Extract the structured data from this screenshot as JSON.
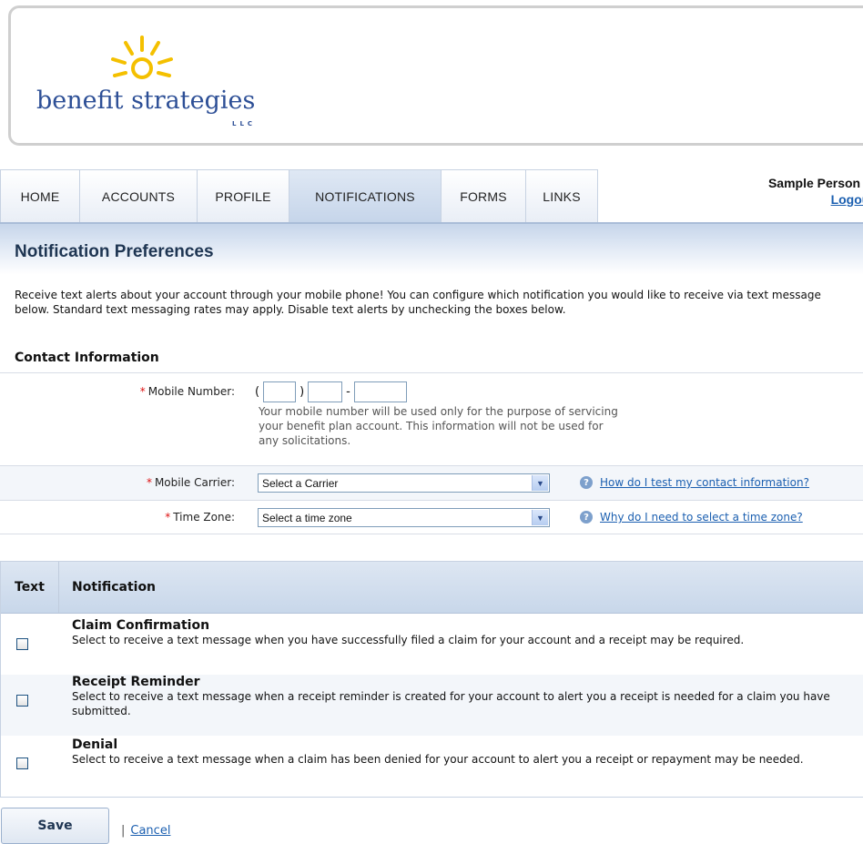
{
  "brand": {
    "name": "benefit strategies",
    "suffix": "LLC",
    "primary_color": "#2d4f96",
    "sun_color": "#f4c000"
  },
  "nav": {
    "tabs": [
      "HOME",
      "ACCOUNTS",
      "PROFILE",
      "NOTIFICATIONS",
      "FORMS",
      "LINKS"
    ],
    "active_tab": "NOTIFICATIONS",
    "user_name": "Sample Person",
    "logout_label": "Logout"
  },
  "page": {
    "title": "Notification Preferences",
    "intro": "Receive text alerts about your account through your mobile phone! You can configure which notification you would like to receive via text message below. Standard text messaging rates may apply. Disable text alerts by unchecking the boxes below."
  },
  "contact": {
    "section_title": "Contact Information",
    "mobile_label": "Mobile Number:",
    "mobile_area": "",
    "mobile_prefix": "",
    "mobile_line": "",
    "mobile_note": "Your mobile number will be used only for the purpose of servicing your benefit plan account. This information will not be used for any solicitations.",
    "carrier_label": "Mobile Carrier:",
    "carrier_value": "Select a Carrier",
    "carrier_help": "How do I test my contact information?",
    "timezone_label": "Time Zone:",
    "timezone_value": "Select a time zone",
    "timezone_help": "Why do I need to select a time zone?"
  },
  "notifications": {
    "col_text": "Text",
    "col_notification": "Notification",
    "items": [
      {
        "title": "Claim Confirmation",
        "description": "Select to receive a text message when you have successfully filed a claim for your account and a receipt may be required.",
        "checked": false
      },
      {
        "title": "Receipt Reminder",
        "description": "Select to receive a text message when a receipt reminder is created for your account to alert you a receipt is needed for a claim you have submitted.",
        "checked": false
      },
      {
        "title": "Denial",
        "description": "Select to receive a text message when a claim has been denied for your account to alert you a receipt or repayment may be needed.",
        "checked": false
      }
    ]
  },
  "actions": {
    "save_label": "Save",
    "separator": "|",
    "cancel_label": "Cancel"
  }
}
